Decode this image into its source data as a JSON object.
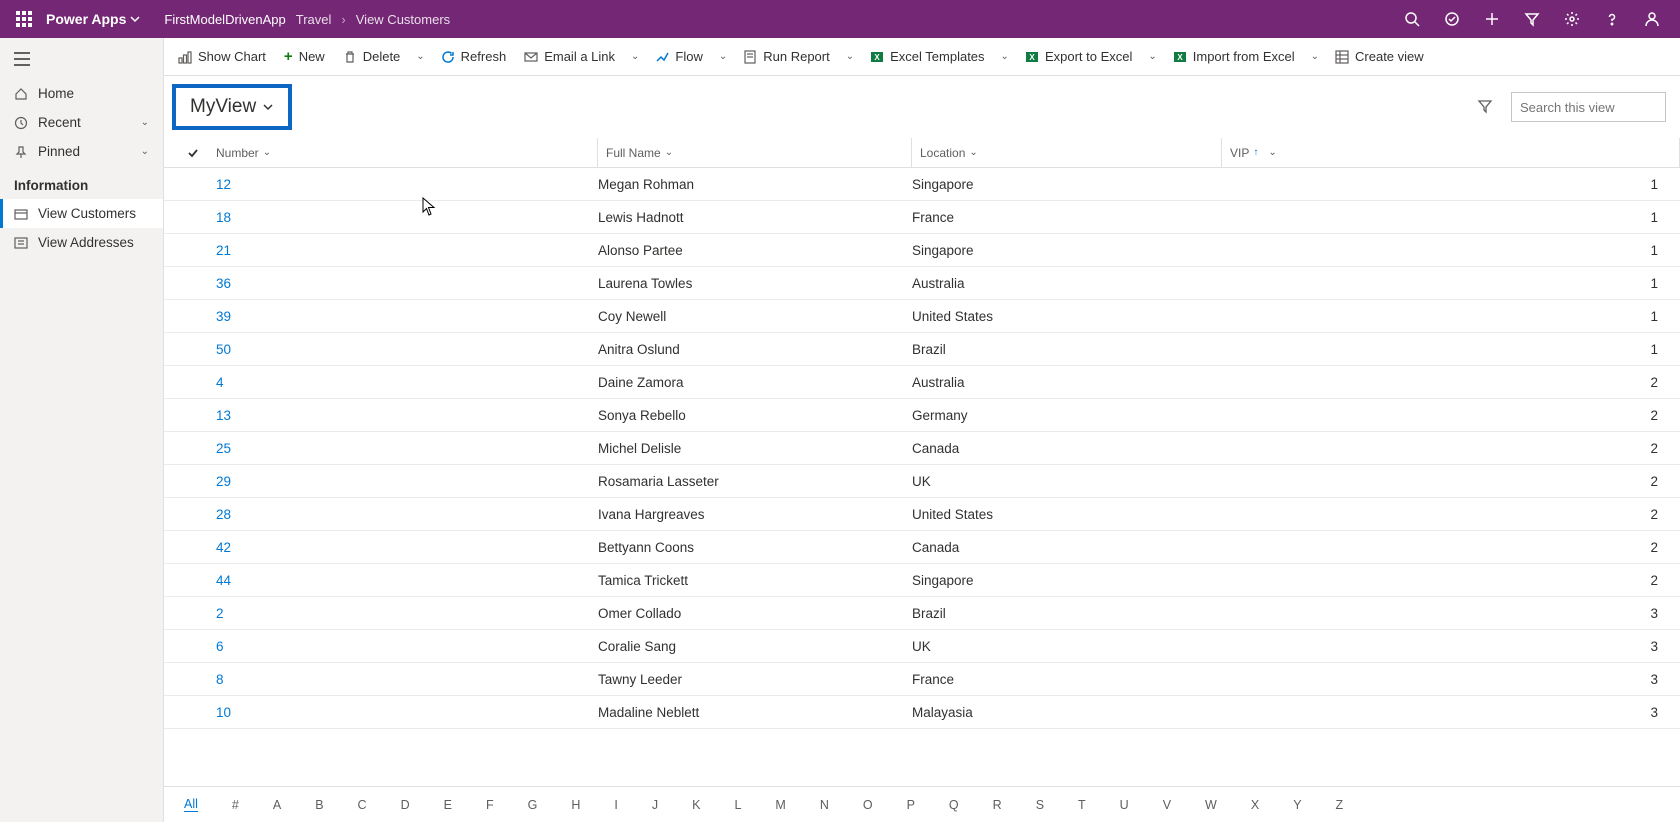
{
  "app": {
    "brand": "Power Apps",
    "app_name": "FirstModelDrivenApp",
    "crumb1": "Travel",
    "crumb2": "View Customers"
  },
  "sidebar": {
    "home": "Home",
    "recent": "Recent",
    "pinned": "Pinned",
    "section": "Information",
    "view_customers": "View Customers",
    "view_addresses": "View Addresses"
  },
  "cmd": {
    "show_chart": "Show Chart",
    "new": "New",
    "delete": "Delete",
    "refresh": "Refresh",
    "email_link": "Email a Link",
    "flow": "Flow",
    "run_report": "Run Report",
    "excel_templates": "Excel Templates",
    "export_excel": "Export to Excel",
    "import_excel": "Import from Excel",
    "create_view": "Create view"
  },
  "view": {
    "name": "MyView",
    "search_placeholder": "Search this view"
  },
  "columns": {
    "number": "Number",
    "full_name": "Full Name",
    "location": "Location",
    "vip": "VIP"
  },
  "rows": [
    {
      "num": "12",
      "full": "Megan Rohman",
      "loc": "Singapore",
      "vip": "1"
    },
    {
      "num": "18",
      "full": "Lewis Hadnott",
      "loc": "France",
      "vip": "1"
    },
    {
      "num": "21",
      "full": "Alonso Partee",
      "loc": "Singapore",
      "vip": "1"
    },
    {
      "num": "36",
      "full": "Laurena Towles",
      "loc": "Australia",
      "vip": "1"
    },
    {
      "num": "39",
      "full": "Coy Newell",
      "loc": "United States",
      "vip": "1"
    },
    {
      "num": "50",
      "full": "Anitra Oslund",
      "loc": "Brazil",
      "vip": "1"
    },
    {
      "num": "4",
      "full": "Daine Zamora",
      "loc": "Australia",
      "vip": "2"
    },
    {
      "num": "13",
      "full": "Sonya Rebello",
      "loc": "Germany",
      "vip": "2"
    },
    {
      "num": "25",
      "full": "Michel Delisle",
      "loc": "Canada",
      "vip": "2"
    },
    {
      "num": "29",
      "full": "Rosamaria Lasseter",
      "loc": "UK",
      "vip": "2"
    },
    {
      "num": "28",
      "full": "Ivana Hargreaves",
      "loc": "United States",
      "vip": "2"
    },
    {
      "num": "42",
      "full": "Bettyann Coons",
      "loc": "Canada",
      "vip": "2"
    },
    {
      "num": "44",
      "full": "Tamica Trickett",
      "loc": "Singapore",
      "vip": "2"
    },
    {
      "num": "2",
      "full": "Omer Collado",
      "loc": "Brazil",
      "vip": "3"
    },
    {
      "num": "6",
      "full": "Coralie Sang",
      "loc": "UK",
      "vip": "3"
    },
    {
      "num": "8",
      "full": "Tawny Leeder",
      "loc": "France",
      "vip": "3"
    },
    {
      "num": "10",
      "full": "Madaline Neblett",
      "loc": "Malayasia",
      "vip": "3"
    }
  ],
  "alphabar": [
    "All",
    "#",
    "A",
    "B",
    "C",
    "D",
    "E",
    "F",
    "G",
    "H",
    "I",
    "J",
    "K",
    "L",
    "M",
    "N",
    "O",
    "P",
    "Q",
    "R",
    "S",
    "T",
    "U",
    "V",
    "W",
    "X",
    "Y",
    "Z"
  ]
}
